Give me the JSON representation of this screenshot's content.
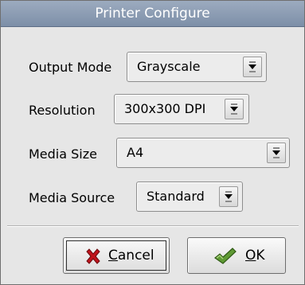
{
  "window": {
    "title": "Printer Configure"
  },
  "fields": [
    {
      "label": "Output Mode",
      "value": "Grayscale"
    },
    {
      "label": "Resolution",
      "value": "300x300 DPI"
    },
    {
      "label": "Media Size",
      "value": "A4"
    },
    {
      "label": "Media Source",
      "value": "Standard"
    }
  ],
  "buttons": {
    "cancel_label": "Cancel",
    "ok_label": "OK"
  },
  "icons": {
    "dropdown": "chevron-down-icon",
    "cancel": "red-x-icon",
    "ok": "green-check-icon"
  },
  "colors": {
    "titlebar": "#8b9bb3",
    "cancel_icon": "#c0141c",
    "ok_icon": "#4f8a2c"
  }
}
